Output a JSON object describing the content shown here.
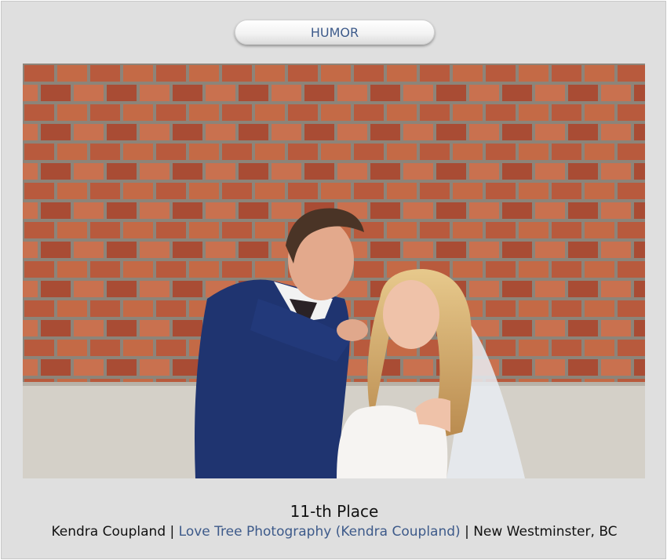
{
  "category": {
    "label": "HUMOR"
  },
  "photo": {
    "subject": "Groom playfully biting bride's lip in front of a red brick wall",
    "colors": {
      "brick": "#b85a3d",
      "mortar": "#8d8479",
      "wall_base": "#d4d0c8",
      "suit": "#1f3470"
    }
  },
  "result": {
    "place": "11-th Place",
    "author": "Kendra Coupland",
    "separator": "|",
    "studio": "Love Tree Photography (Kendra Coupland)",
    "location": "New Westminster, BC"
  },
  "colors": {
    "link": "#3d5a8a",
    "background": "#dfdfdf"
  }
}
